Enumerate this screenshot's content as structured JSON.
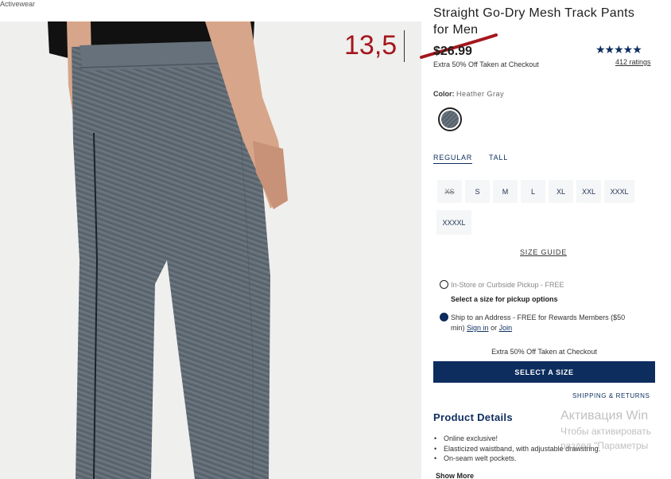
{
  "breadcrumb": "Activewear",
  "overlay": {
    "handwritten_price": "13,5"
  },
  "product": {
    "title": "Straight Go-Dry Mesh Track Pants for Men",
    "price": "$26.99",
    "promo": "Extra 50% Off Taken at Checkout",
    "stars": "★★★★★",
    "rating_value": 5,
    "ratings_count": "412 ratings"
  },
  "color": {
    "label": "Color:",
    "value": "Heather Gray"
  },
  "fit_tabs": [
    {
      "label": "REGULAR",
      "active": true
    },
    {
      "label": "TALL",
      "active": false
    }
  ],
  "sizes": [
    {
      "label": "XS",
      "available": false
    },
    {
      "label": "S",
      "available": true
    },
    {
      "label": "M",
      "available": true
    },
    {
      "label": "L",
      "available": true
    },
    {
      "label": "XL",
      "available": true
    },
    {
      "label": "XXL",
      "available": true
    },
    {
      "label": "XXXL",
      "available": true
    },
    {
      "label": "XXXXL",
      "available": true
    }
  ],
  "size_guide": "SIZE GUIDE",
  "fulfillment": {
    "pickup_label": "In-Store or Curbside Pickup - FREE",
    "pickup_note": "Select a size for pickup options",
    "ship_label_1": "Ship to an Address - FREE for Rewards Members ($50",
    "ship_label_2": "min)",
    "sign_in": "Sign in",
    "or": "or",
    "join": "Join"
  },
  "checkout_note": "Extra 50% Off Taken at Checkout",
  "select_button": "SELECT A SIZE",
  "shipping_returns": "SHIPPING & RETURNS",
  "details": {
    "title": "Product Details",
    "bullets": [
      "Online exclusive!",
      "Elasticized waistband, with adjustable drawstring.",
      "On-seam welt pockets."
    ],
    "show_more": "Show More"
  },
  "watermark": {
    "line1": "Активация Win",
    "line2": "Чтобы активировать",
    "line3": "раздел \"Параметры"
  },
  "colors": {
    "navy": "#0d2d5e",
    "red_annotation": "#a4171d",
    "fabric": "#5e6972"
  }
}
